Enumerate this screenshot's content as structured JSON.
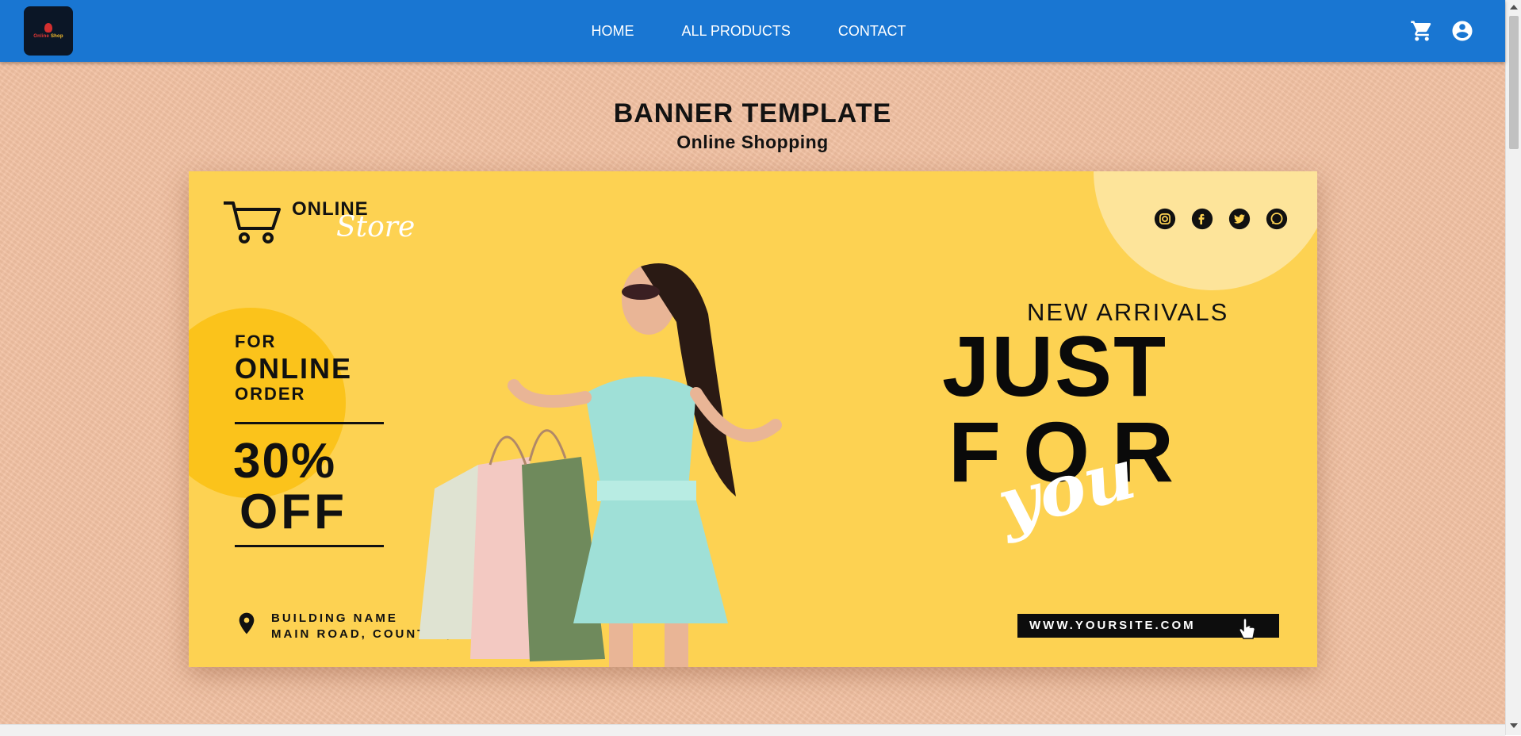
{
  "nav": {
    "links": [
      "HOME",
      "ALL PRODUCTS",
      "CONTACT"
    ],
    "logo_alt": "Online Shop",
    "cart_icon": "cart-icon",
    "account_icon": "account-circle-icon",
    "bar_color": "#1976d2"
  },
  "hero": {
    "title": "BANNER TEMPLATE",
    "subtitle": "Online Shopping",
    "background_color": "#f2c1a2"
  },
  "banner": {
    "background_color": "#fdd252",
    "store_online": "ONLINE",
    "store_script": "Store",
    "promo_for": "FOR",
    "promo_online": "ONLINE",
    "promo_order": "ORDER",
    "discount": "30%",
    "discount_off": "OFF",
    "address_line1": "BUILDING NAME",
    "address_line2": "MAIN ROAD, COUNTRY, 45612",
    "social_icons": [
      "instagram-icon",
      "facebook-icon",
      "twitter-icon",
      "whatsapp-icon"
    ],
    "new_arrivals": "NEW ARRIVALS",
    "headline_just": "JUST",
    "headline_for": "FOR",
    "headline_script": "you",
    "website": "WWW.YOURSITE.COM"
  }
}
